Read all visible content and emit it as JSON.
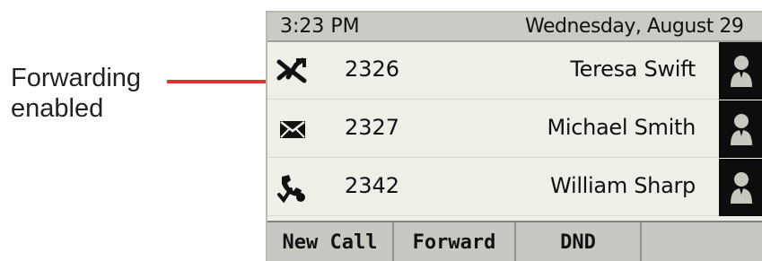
{
  "callout": {
    "line1": "Forwarding",
    "line2": "enabled",
    "color": "#e0312f"
  },
  "status_bar": {
    "time": "3:23 PM",
    "date": "Wednesday, August 29"
  },
  "lines": [
    {
      "icon": "call-forward-icon",
      "extension": "2326",
      "name": "Teresa Swift",
      "avatar": "contact-avatar-icon"
    },
    {
      "icon": "envelope-icon",
      "extension": "2327",
      "name": "Michael Smith",
      "avatar": "contact-avatar-icon"
    },
    {
      "icon": "shared-line-phone-icon",
      "extension": "2342",
      "name": "William Sharp",
      "avatar": "contact-avatar-icon"
    }
  ],
  "softkeys": [
    "New Call",
    "Forward",
    "DND",
    ""
  ]
}
